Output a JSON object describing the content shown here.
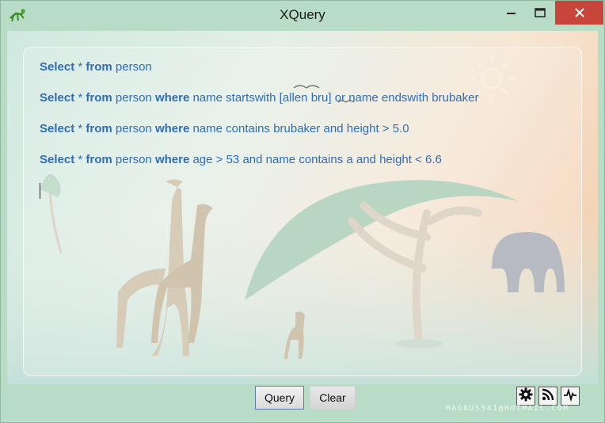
{
  "window": {
    "title": "XQuery",
    "icons": {
      "app": "grasshopper-icon",
      "minimize": "minimize-icon",
      "maximize": "maximize-icon",
      "close": "close-icon"
    },
    "colors": {
      "close_button": "#c7453a",
      "query_text": "#2f6db5"
    }
  },
  "editor": {
    "lines": [
      [
        {
          "t": "Select",
          "k": true
        },
        {
          "t": " * ",
          "k": false
        },
        {
          "t": "from",
          "k": true
        },
        {
          "t": " person",
          "k": false
        }
      ],
      [
        {
          "t": "Select",
          "k": true
        },
        {
          "t": " * ",
          "k": false
        },
        {
          "t": "from",
          "k": true
        },
        {
          "t": " person ",
          "k": false
        },
        {
          "t": "where",
          "k": true
        },
        {
          "t": " name startswith [allen bru] or name endswith brubaker",
          "k": false
        }
      ],
      [
        {
          "t": "Select",
          "k": true
        },
        {
          "t": " * ",
          "k": false
        },
        {
          "t": "from",
          "k": true
        },
        {
          "t": " person ",
          "k": false
        },
        {
          "t": "where",
          "k": true
        },
        {
          "t": " name contains brubaker and height > 5.0",
          "k": false
        }
      ],
      [
        {
          "t": "Select",
          "k": true
        },
        {
          "t": " * ",
          "k": false
        },
        {
          "t": "from",
          "k": true
        },
        {
          "t": " person ",
          "k": false
        },
        {
          "t": "where",
          "k": true
        },
        {
          "t": " age > 53 and name contains a and height < 6.6",
          "k": false
        }
      ]
    ]
  },
  "buttons": {
    "query": "Query",
    "clear": "Clear"
  },
  "toolbar_icons": [
    "settings-icon",
    "rss-icon",
    "pulse-icon"
  ],
  "watermark": "MAGNUS541@HOTMAIL.COM"
}
